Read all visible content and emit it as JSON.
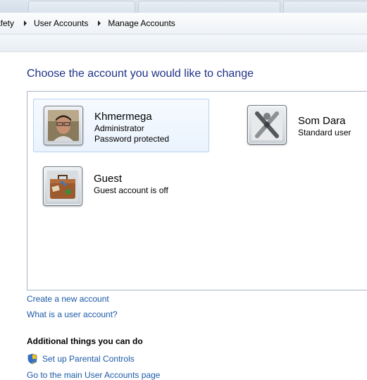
{
  "breadcrumb": {
    "items": [
      "afety",
      "User Accounts",
      "Manage Accounts"
    ]
  },
  "main": {
    "heading": "Choose the account you would like to change",
    "accounts": [
      {
        "name": "Khmermega",
        "line1": "Administrator",
        "line2": "Password protected",
        "picture": "person-photo",
        "selected": true
      },
      {
        "name": "Som Dara",
        "line1": "Standard user",
        "line2": "",
        "picture": "grey-figure-icon",
        "selected": false
      },
      {
        "name": "Guest",
        "line1": "Guest account is off",
        "line2": "",
        "picture": "suitcase-icon",
        "selected": false
      }
    ]
  },
  "links": {
    "create_account": "Create a new account",
    "what_is_account": "What is a user account?"
  },
  "additional": {
    "title": "Additional things you can do",
    "parental_controls": "Set up Parental Controls",
    "main_page": "Go to the main User Accounts page"
  },
  "colors": {
    "heading": "#1e3287",
    "link": "#1c5aa6",
    "selected_bg": "#eaf3fd",
    "selected_border": "#b9d3ef"
  }
}
